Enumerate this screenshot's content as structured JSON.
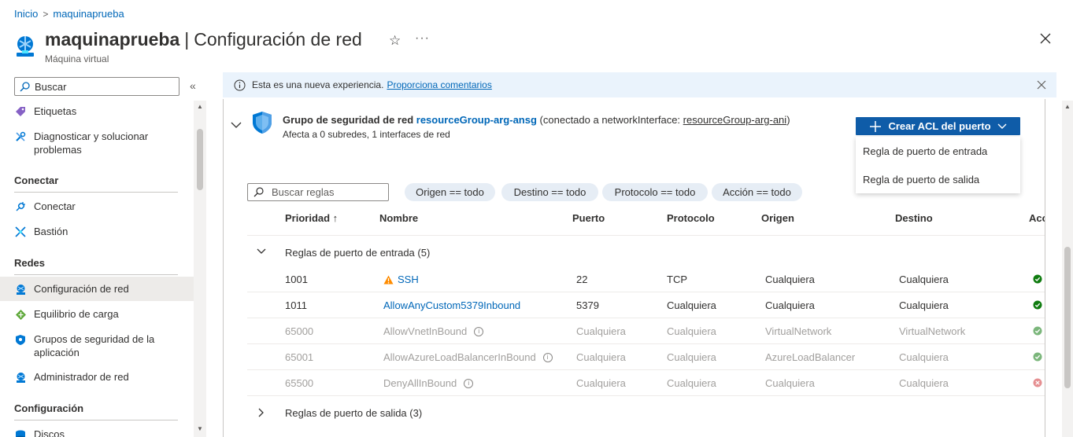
{
  "breadcrumb": {
    "home": "Inicio",
    "current": "maquinaprueba"
  },
  "header": {
    "name": "maquinaprueba",
    "separator": "|",
    "page": "Configuración de red",
    "subtitle": "Máquina virtual",
    "more": "···"
  },
  "sidebar": {
    "search_placeholder": "Buscar",
    "collapse": "«",
    "items": [
      {
        "label": "Etiquetas",
        "icon": "tag-icon"
      },
      {
        "label": "Diagnosticar y solucionar problemas",
        "icon": "wrench-icon"
      },
      {
        "section": "Conectar"
      },
      {
        "label": "Conectar",
        "icon": "plug-icon"
      },
      {
        "label": "Bastión",
        "icon": "bastion-icon"
      },
      {
        "section": "Redes"
      },
      {
        "label": "Configuración de red",
        "icon": "network-icon",
        "active": true
      },
      {
        "label": "Equilibrio de carga",
        "icon": "load-balancer-icon"
      },
      {
        "label": "Grupos de seguridad de la aplicación",
        "icon": "shield-icon"
      },
      {
        "label": "Administrador de red",
        "icon": "network-manager-icon"
      },
      {
        "section": "Configuración"
      },
      {
        "label": "Discos",
        "icon": "disk-icon"
      }
    ]
  },
  "info_bar": {
    "text": "Esta es una nueva experiencia.",
    "link": "Proporciona comentarios"
  },
  "nsg": {
    "title_prefix": "Grupo de seguridad de red",
    "name": "resourceGroup-arg-ansg",
    "connected_prefix": "(conectado a networkInterface:",
    "interface": "resourceGroup-arg-ani",
    "connected_suffix": ")",
    "affects": "Afecta a 0 subredes, 1 interfaces de red"
  },
  "create_acl": {
    "label": "Crear ACL del puerto",
    "menu": [
      "Regla de puerto de entrada",
      "Regla de puerto de salida"
    ]
  },
  "filters": {
    "search_placeholder": "Buscar reglas",
    "pills": [
      "Origen == todo",
      "Destino == todo",
      "Protocolo == todo",
      "Acción == todo"
    ]
  },
  "table": {
    "columns": [
      "Prioridad ↑",
      "Nombre",
      "Puerto",
      "Protocolo",
      "Origen",
      "Destino",
      "Acc"
    ],
    "inbound_group": "Reglas de puerto de entrada (5)",
    "outbound_group": "Reglas de puerto de salida (3)",
    "rows": [
      {
        "priority": "1001",
        "name": "SSH",
        "port": "22",
        "protocol": "TCP",
        "source": "Cualquiera",
        "destination": "Cualquiera",
        "action": "allow",
        "warning": true,
        "default": false
      },
      {
        "priority": "1011",
        "name": "AllowAnyCustom5379Inbound",
        "port": "5379",
        "protocol": "Cualquiera",
        "source": "Cualquiera",
        "destination": "Cualquiera",
        "action": "allow",
        "warning": false,
        "default": false
      },
      {
        "priority": "65000",
        "name": "AllowVnetInBound",
        "port": "Cualquiera",
        "protocol": "Cualquiera",
        "source": "VirtualNetwork",
        "destination": "VirtualNetwork",
        "action": "allow",
        "warning": false,
        "default": true
      },
      {
        "priority": "65001",
        "name": "AllowAzureLoadBalancerInBound",
        "port": "Cualquiera",
        "protocol": "Cualquiera",
        "source": "AzureLoadBalancer",
        "destination": "Cualquiera",
        "action": "allow",
        "warning": false,
        "default": true
      },
      {
        "priority": "65500",
        "name": "DenyAllInBound",
        "port": "Cualquiera",
        "protocol": "Cualquiera",
        "source": "Cualquiera",
        "destination": "Cualquiera",
        "action": "deny",
        "warning": false,
        "default": true
      }
    ]
  },
  "colors": {
    "accent": "#0f5ca8",
    "link": "#0067b8",
    "allow": "#107c10",
    "deny": "#d13438",
    "info_bg": "#eaf3fc"
  }
}
